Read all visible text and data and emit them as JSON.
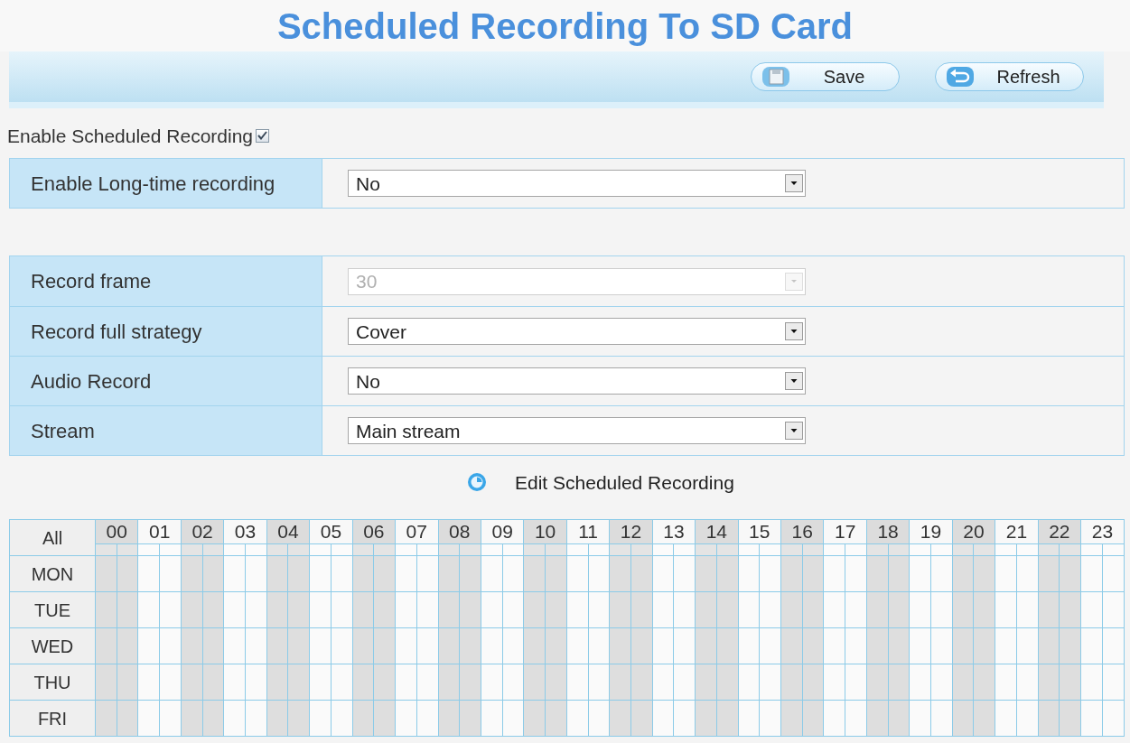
{
  "title": "Scheduled Recording To SD Card",
  "toolbar": {
    "buttons": [
      {
        "kind": "save",
        "label": "Save"
      },
      {
        "kind": "refresh",
        "label": "Refresh"
      }
    ]
  },
  "enable_scheduled": {
    "label": "Enable Scheduled Recording",
    "checked": true
  },
  "long_time": {
    "rows": [
      {
        "label": "Enable Long-time recording",
        "value": "No",
        "disabled": false
      }
    ]
  },
  "settings": {
    "rows": [
      {
        "label": "Record frame",
        "value": "30",
        "disabled": true
      },
      {
        "label": "Record full strategy",
        "value": "Cover",
        "disabled": false
      },
      {
        "label": "Audio Record",
        "value": "No",
        "disabled": false
      },
      {
        "label": "Stream",
        "value": "Main stream",
        "disabled": false
      }
    ]
  },
  "edit_schedule": {
    "label": "Edit Scheduled Recording"
  },
  "schedule": {
    "corner_label": "All",
    "hours": [
      "00",
      "01",
      "02",
      "03",
      "04",
      "05",
      "06",
      "07",
      "08",
      "09",
      "10",
      "11",
      "12",
      "13",
      "14",
      "15",
      "16",
      "17",
      "18",
      "19",
      "20",
      "21",
      "22",
      "23"
    ],
    "days": [
      "MON",
      "TUE",
      "WED",
      "THU",
      "FRI"
    ]
  }
}
